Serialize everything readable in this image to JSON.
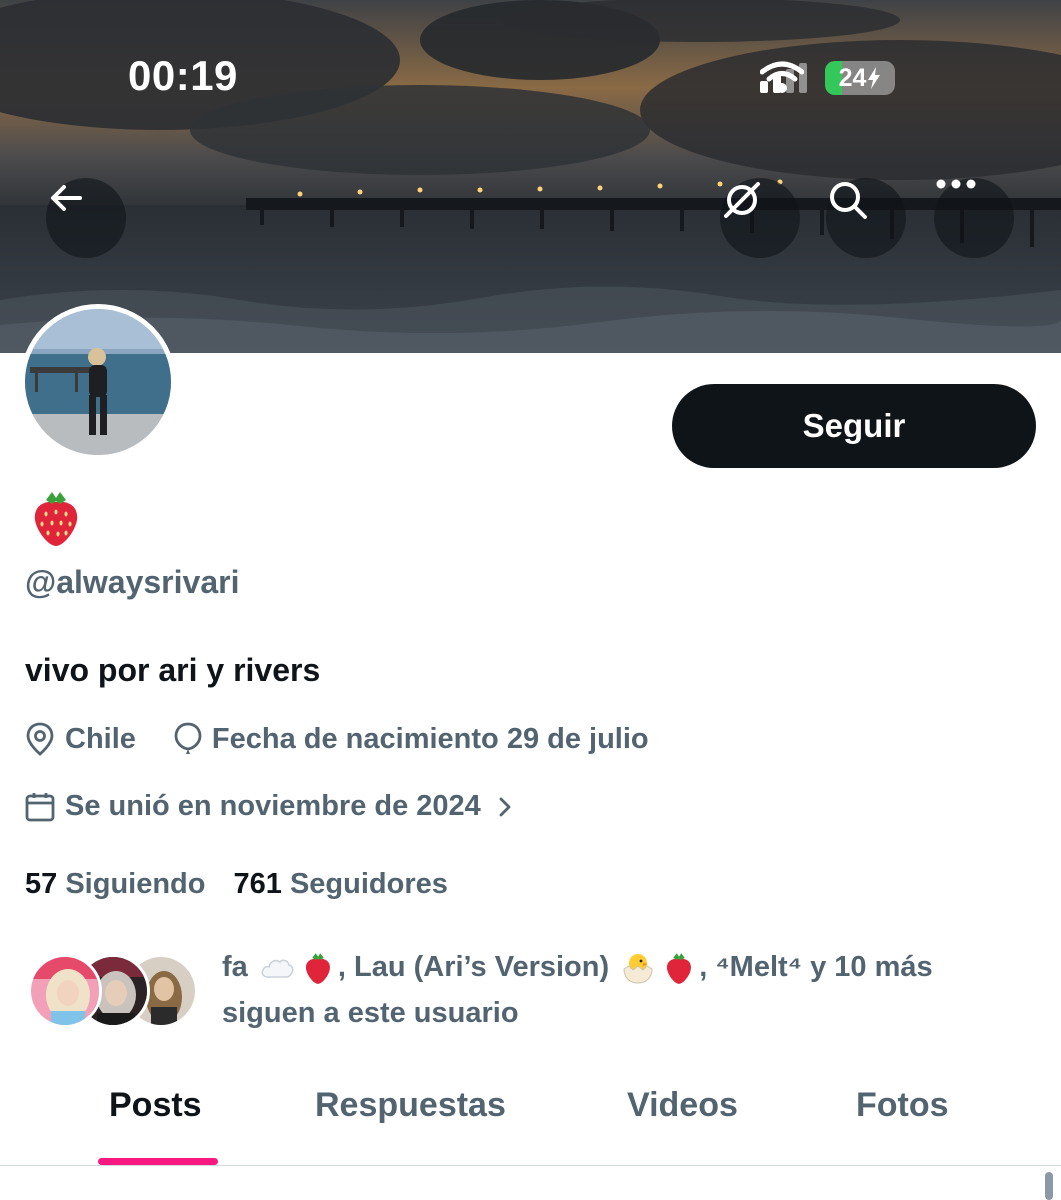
{
  "status_bar": {
    "time": "00:19",
    "battery": "24"
  },
  "header": {
    "icons": [
      "back-arrow-icon",
      "grok-icon",
      "search-icon",
      "more-icon"
    ]
  },
  "profile": {
    "display_name_emoji": "strawberry",
    "handle": "@alwaysrivari",
    "bio": "vivo por ari y rivers",
    "location": "Chile",
    "birthday": "Fecha de nacimiento 29 de julio",
    "joined": "Se unió en noviembre de 2024",
    "follow_label": "Seguir"
  },
  "counts": {
    "following_num": "57",
    "following_label": "Siguiendo",
    "followers_num": "761",
    "followers_label": "Seguidores"
  },
  "known_followers": {
    "name1": "fa",
    "name2": ", Lau (Ari’s Version)",
    "name3": ", ⁴Melt⁴ y 10 más",
    "line2": "siguen a este usuario"
  },
  "tabs": [
    {
      "label": "Posts"
    },
    {
      "label": "Respuestas"
    },
    {
      "label": "Videos"
    },
    {
      "label": "Fotos"
    }
  ],
  "colors": {
    "accent": "#f91880",
    "button_bg": "#0f1419",
    "secondary_text": "#536471"
  }
}
